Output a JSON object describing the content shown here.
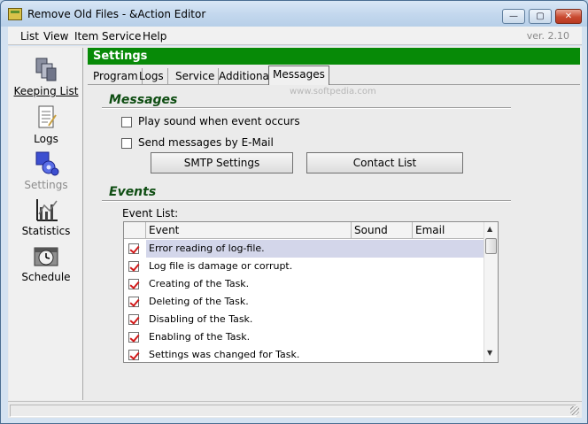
{
  "window": {
    "title": "Remove Old Files - &Action Editor",
    "version": "ver. 2.10",
    "controls": {
      "minimize": "—",
      "maximize": "▢",
      "close": "✕"
    }
  },
  "menu": {
    "items": [
      "List",
      "View",
      "Item",
      "Service",
      "Help"
    ]
  },
  "sidebar": {
    "items": [
      {
        "label": "Keeping List",
        "icon": "files-icon",
        "enabled": true
      },
      {
        "label": "Logs",
        "icon": "log-document-icon",
        "enabled": true
      },
      {
        "label": "Settings",
        "icon": "gears-icon",
        "enabled": false
      },
      {
        "label": "Statistics",
        "icon": "chart-icon",
        "enabled": true
      },
      {
        "label": "Schedule",
        "icon": "clock-icon",
        "enabled": true
      }
    ]
  },
  "main": {
    "header": "Settings",
    "watermark": "www.softpedia.com",
    "tabs": [
      "Program",
      "Logs",
      "Service",
      "Additional",
      "Messages"
    ],
    "active_tab": "Messages",
    "messages": {
      "title": "Messages",
      "play_sound_label": "Play sound when event occurs",
      "play_sound_checked": false,
      "send_email_label": "Send messages by E-Mail",
      "send_email_checked": false,
      "smtp_button": "SMTP Settings",
      "contact_button": "Contact List"
    },
    "events": {
      "title": "Events",
      "list_label": "Event List:",
      "columns": [
        "Event",
        "Sound",
        "Email"
      ],
      "rows": [
        {
          "event": "Error reading of log-file.",
          "checked": true,
          "selected": true
        },
        {
          "event": "Log file is damage or corrupt.",
          "checked": true,
          "selected": false
        },
        {
          "event": "Creating of the Task.",
          "checked": true,
          "selected": false
        },
        {
          "event": "Deleting of the Task.",
          "checked": true,
          "selected": false
        },
        {
          "event": "Disabling of the Task.",
          "checked": true,
          "selected": false
        },
        {
          "event": "Enabling of the Task.",
          "checked": true,
          "selected": false
        },
        {
          "event": "Settings was changed for Task.",
          "checked": true,
          "selected": false
        }
      ]
    }
  }
}
